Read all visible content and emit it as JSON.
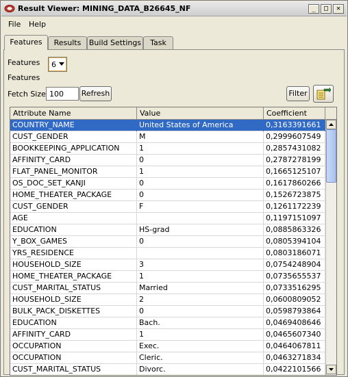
{
  "window": {
    "title": "Result Viewer: MINING_DATA_B26645_NF"
  },
  "titlebar_buttons": {
    "minimize": "_",
    "maximize": "□",
    "close": "✕"
  },
  "menu": {
    "file": "File",
    "help": "Help"
  },
  "tabs": [
    "Features",
    "Results",
    "Build Settings",
    "Task"
  ],
  "features": {
    "label_top": "Features",
    "label_bottom": "Features",
    "count": "6"
  },
  "fetch": {
    "label": "Fetch Size:",
    "value": "100",
    "refresh_label": "Refresh"
  },
  "filter_label": "Filter",
  "table": {
    "columns": [
      "Attribute Name",
      "Value",
      "Coefficient"
    ],
    "rows": [
      [
        "COUNTRY_NAME",
        "United States of America",
        "0,3163391661"
      ],
      [
        "CUST_GENDER",
        "M",
        "0,2999607549"
      ],
      [
        "BOOKKEEPING_APPLICATION",
        "1",
        "0,2857431082"
      ],
      [
        "AFFINITY_CARD",
        "0",
        "0,2787278199"
      ],
      [
        "FLAT_PANEL_MONITOR",
        "1",
        "0,1665125107"
      ],
      [
        "OS_DOC_SET_KANJI",
        "0",
        "0,1617860266"
      ],
      [
        "HOME_THEATER_PACKAGE",
        "0",
        "0,1526723875"
      ],
      [
        "CUST_GENDER",
        "F",
        "0,1261172239"
      ],
      [
        "AGE",
        "",
        "0,1197151097"
      ],
      [
        "EDUCATION",
        "HS-grad",
        "0,0885863326"
      ],
      [
        "Y_BOX_GAMES",
        "0",
        "0,0805394104"
      ],
      [
        "YRS_RESIDENCE",
        "",
        "0,0803186071"
      ],
      [
        "HOUSEHOLD_SIZE",
        "3",
        "0,0754248904"
      ],
      [
        "HOME_THEATER_PACKAGE",
        "1",
        "0,0735655537"
      ],
      [
        "CUST_MARITAL_STATUS",
        "Married",
        "0,0733516295"
      ],
      [
        "HOUSEHOLD_SIZE",
        "2",
        "0,0600809052"
      ],
      [
        "BULK_PACK_DISKETTES",
        "0",
        "0,0598793864"
      ],
      [
        "EDUCATION",
        "Bach.",
        "0,0469408646"
      ],
      [
        "AFFINITY_CARD",
        "1",
        "0,0465607340"
      ],
      [
        "OCCUPATION",
        "Exec.",
        "0,0464067811"
      ],
      [
        "OCCUPATION",
        "Cleric.",
        "0,0463271834"
      ],
      [
        "CUST_MARITAL_STATUS",
        "Divorc.",
        "0,0422101566"
      ]
    ],
    "selected_row": 0
  },
  "colors": {
    "selection": "#316ac5",
    "accent": "#e8b34a"
  }
}
